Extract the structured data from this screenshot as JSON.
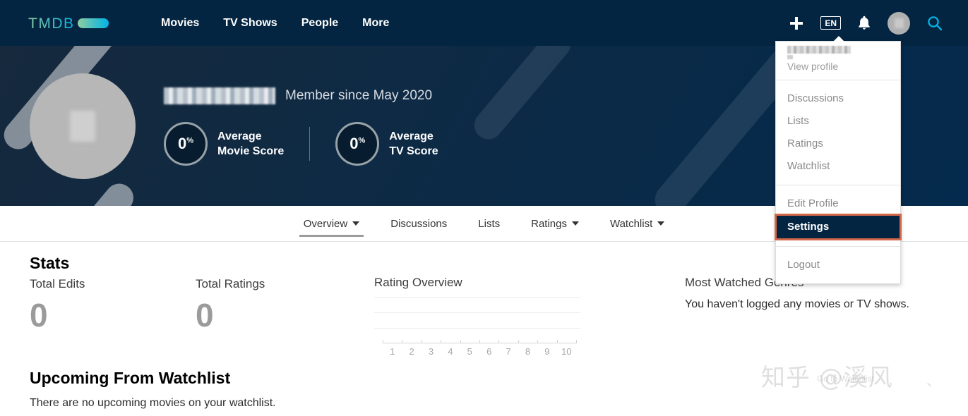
{
  "header": {
    "logo_text": "TMDB",
    "nav": [
      {
        "label": "Movies"
      },
      {
        "label": "TV Shows"
      },
      {
        "label": "People"
      },
      {
        "label": "More"
      }
    ],
    "add_icon": "plus-icon",
    "language": "EN",
    "notifications_icon": "bell-icon",
    "avatar_icon": "user-avatar",
    "search_icon": "search-icon",
    "background_color": "#032541"
  },
  "account_menu": {
    "username": "",
    "view_profile": "View profile",
    "group_one": [
      "Discussions",
      "Lists",
      "Ratings",
      "Watchlist"
    ],
    "group_two": [
      "Edit Profile",
      "Settings"
    ],
    "group_three": [
      "Logout"
    ],
    "active_item": "Settings",
    "highlight_color": "#d4694a",
    "active_bg": "#032541"
  },
  "profile": {
    "display_name": "",
    "member_since": "Member since May 2020",
    "scores": [
      {
        "value": "0",
        "unit": "%",
        "label_line1": "Average",
        "label_line2": "Movie Score"
      },
      {
        "value": "0",
        "unit": "%",
        "label_line1": "Average",
        "label_line2": "TV Score"
      }
    ]
  },
  "tabs": [
    {
      "label": "Overview",
      "has_caret": true,
      "active": true
    },
    {
      "label": "Discussions",
      "has_caret": false,
      "active": false
    },
    {
      "label": "Lists",
      "has_caret": false,
      "active": false
    },
    {
      "label": "Ratings",
      "has_caret": true,
      "active": false
    },
    {
      "label": "Watchlist",
      "has_caret": true,
      "active": false
    }
  ],
  "stats": {
    "title": "Stats",
    "total_edits_label": "Total Edits",
    "total_edits_value": "0",
    "total_ratings_label": "Total Ratings",
    "total_ratings_value": "0"
  },
  "genres": {
    "title": "Most Watched Genres",
    "empty_message": "You haven't logged any movies or TV shows."
  },
  "upcoming": {
    "title": "Upcoming From Watchlist",
    "empty_message": "There are no upcoming movies on your watchlist."
  },
  "watermark": {
    "text": "知乎 @溪风",
    "sub": "Go to Watchlist",
    "tick": "、"
  },
  "chart_data": {
    "type": "bar",
    "title": "Rating Overview",
    "categories": [
      "1",
      "2",
      "3",
      "4",
      "5",
      "6",
      "7",
      "8",
      "9",
      "10"
    ],
    "values": [
      0,
      0,
      0,
      0,
      0,
      0,
      0,
      0,
      0,
      0
    ],
    "xlabel": "",
    "ylabel": "",
    "ylim": [
      0,
      3
    ],
    "gridlines": 3,
    "grid": true,
    "legend": "none"
  }
}
